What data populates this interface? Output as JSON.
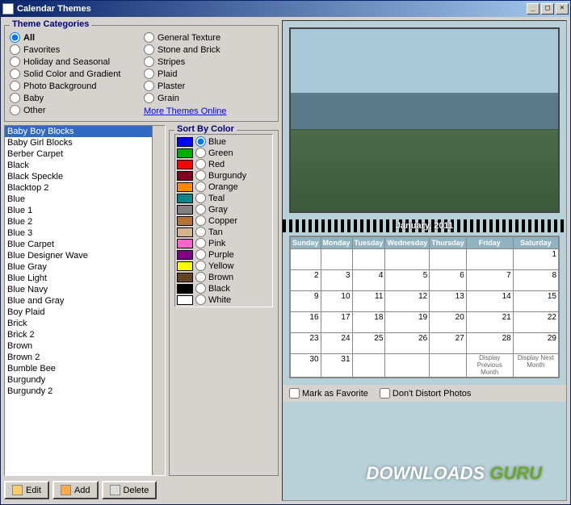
{
  "window": {
    "title": "Calendar Themes"
  },
  "categories": {
    "legend": "Theme Categories",
    "left": [
      "All",
      "Favorites",
      "Holiday and Seasonal",
      "Solid Color and Gradient",
      "Photo Background",
      "Baby",
      "Other"
    ],
    "right": [
      "General Texture",
      "Stone and Brick",
      "Stripes",
      "Plaid",
      "Plaster",
      "Grain"
    ],
    "selected": "All",
    "more_link": "More Themes Online"
  },
  "themes": {
    "selected": "Baby Boy Blocks",
    "items": [
      "Baby Boy Blocks",
      "Baby Girl Blocks",
      "Berber Carpet",
      "Black",
      "Black Speckle",
      "Blacktop 2",
      "Blue",
      "Blue 1",
      "Blue 2",
      "Blue 3",
      "Blue Carpet",
      "Blue Designer Wave",
      "Blue Gray",
      "Blue Light",
      "Blue Navy",
      "Blue and Gray",
      "Boy Plaid",
      "Brick",
      "Brick 2",
      "Brown",
      "Brown 2",
      "Bumble Bee",
      "Burgundy",
      "Burgundy 2"
    ]
  },
  "sort": {
    "legend": "Sort By Color",
    "selected": "Blue",
    "colors": [
      {
        "name": "Blue",
        "hex": "#0000ff"
      },
      {
        "name": "Green",
        "hex": "#00aa00"
      },
      {
        "name": "Red",
        "hex": "#ff0000"
      },
      {
        "name": "Burgundy",
        "hex": "#800020"
      },
      {
        "name": "Orange",
        "hex": "#ff8800"
      },
      {
        "name": "Teal",
        "hex": "#008888"
      },
      {
        "name": "Gray",
        "hex": "#808080"
      },
      {
        "name": "Copper",
        "hex": "#b87333"
      },
      {
        "name": "Tan",
        "hex": "#d2b48c"
      },
      {
        "name": "Pink",
        "hex": "#ff66cc"
      },
      {
        "name": "Purple",
        "hex": "#800080"
      },
      {
        "name": "Yellow",
        "hex": "#ffff00"
      },
      {
        "name": "Brown",
        "hex": "#664422"
      },
      {
        "name": "Black",
        "hex": "#000000"
      },
      {
        "name": "White",
        "hex": "#ffffff"
      }
    ]
  },
  "buttons": {
    "edit": "Edit",
    "add": "Add",
    "delete": "Delete"
  },
  "preview": {
    "month_label": "January, 2011",
    "days": [
      "Sunday",
      "Monday",
      "Tuesday",
      "Wednesday",
      "Thursday",
      "Friday",
      "Saturday"
    ],
    "weeks": [
      [
        "",
        "",
        "",
        "",
        "",
        "1"
      ],
      [
        "2",
        "3",
        "4",
        "5",
        "6",
        "7",
        "8"
      ],
      [
        "9",
        "10",
        "11",
        "12",
        "13",
        "14",
        "15"
      ],
      [
        "16",
        "17",
        "18",
        "19",
        "20",
        "21",
        "22"
      ],
      [
        "23",
        "24",
        "25",
        "26",
        "27",
        "28"
      ],
      [
        "30",
        "31",
        "",
        "",
        "",
        ""
      ]
    ],
    "first_row_sat": "1",
    "prev_label": "Display Previous Month",
    "next_label": "Display Next Month",
    "row5_last": "29"
  },
  "options": {
    "fav": "Mark as Favorite",
    "distort": "Don't Distort Photos"
  },
  "watermark": {
    "a": "DOWNLOADS",
    "b": "GURU"
  }
}
